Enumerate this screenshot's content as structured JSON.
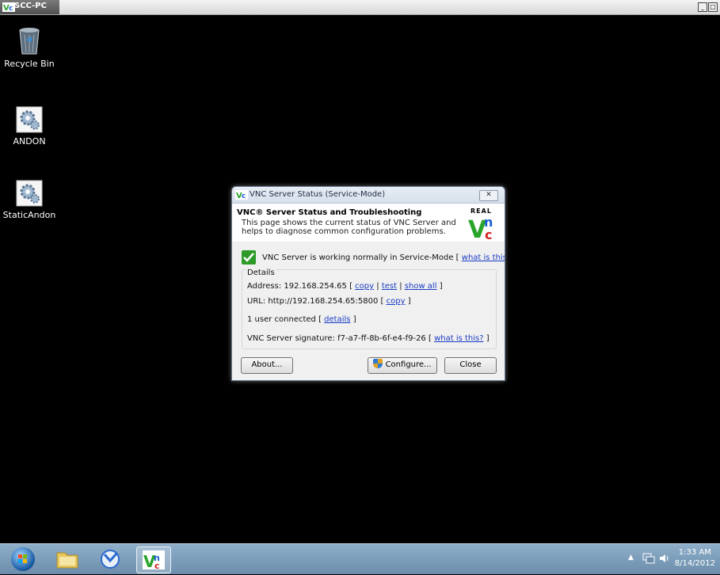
{
  "window": {
    "title": "SCC-PC"
  },
  "desktop": {
    "icons": [
      {
        "label": "Recycle Bin",
        "icon": "recycle-bin-icon"
      },
      {
        "label": "ANDON",
        "icon": "gear-app-icon"
      },
      {
        "label": "StaticAndon",
        "icon": "gear-app-icon"
      }
    ]
  },
  "dialog": {
    "title": "VNC Server Status (Service-Mode)",
    "close_label": "✕",
    "header": {
      "title": "VNC® Server Status and Troubleshooting",
      "description": "This page shows the current status of VNC Server and helps to diagnose common configuration problems.",
      "logo_text": "REAL",
      "logo_letters": "VNC"
    },
    "status": {
      "text": "VNC Server is working normally in Service-Mode [",
      "link": "what is this?",
      "suffix": "]"
    },
    "details": {
      "legend": "Details",
      "address_label": "Address: 192.168.254.65 [",
      "address_links": [
        "copy",
        "test",
        "show all"
      ],
      "url_label": "URL: http://192.168.254.65:5800 [",
      "url_link": "copy",
      "users_label": "1 user connected [",
      "users_link": "details",
      "signature_label": "VNC Server signature: f7-a7-ff-8b-6f-e4-f9-26 [",
      "signature_link": "what is this?",
      "close_bracket": "]",
      "sep": "|"
    },
    "buttons": {
      "about": "About...",
      "configure": "Configure...",
      "close": "Close"
    }
  },
  "taskbar": {
    "apps": [
      "windows-explorer",
      "remote-app",
      "vnc-server"
    ],
    "clock": {
      "time": "1:33 AM",
      "date": "8/14/2012"
    }
  },
  "colors": {
    "desktop": "#000000",
    "link": "#1a3cc4",
    "check": "#2e9a2a",
    "vnc_green": "#2aa42a",
    "vnc_blue": "#1a5fd6",
    "vnc_red": "#d62020"
  }
}
